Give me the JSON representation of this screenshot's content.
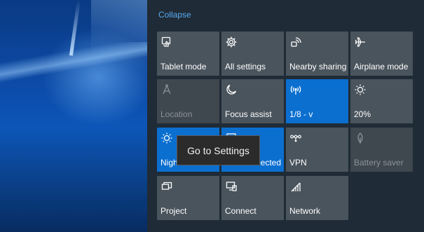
{
  "action_center": {
    "collapse_label": "Collapse",
    "tooltip": "Go to Settings",
    "tiles": [
      {
        "label": "Tablet mode",
        "icon": "tablet-mode-icon",
        "state": "off"
      },
      {
        "label": "All settings",
        "icon": "gear-icon",
        "state": "off"
      },
      {
        "label": "Nearby sharing",
        "icon": "nearby-sharing-icon",
        "state": "off"
      },
      {
        "label": "Airplane mode",
        "icon": "airplane-icon",
        "state": "off"
      },
      {
        "label": "Location",
        "icon": "location-icon",
        "state": "disabled"
      },
      {
        "label": "Focus assist",
        "icon": "moon-icon",
        "state": "off"
      },
      {
        "label": "1/8 - v",
        "icon": "mobile-hotspot-icon",
        "state": "on"
      },
      {
        "label": "20%",
        "icon": "brightness-icon",
        "state": "off"
      },
      {
        "label": "Nigh",
        "icon": "night-light-icon",
        "state": "on"
      },
      {
        "label": "ected",
        "icon": "network-connected-icon",
        "state": "on"
      },
      {
        "label": "VPN",
        "icon": "vpn-icon",
        "state": "off"
      },
      {
        "label": "Battery saver",
        "icon": "battery-saver-icon",
        "state": "disabled"
      },
      {
        "label": "Project",
        "icon": "project-icon",
        "state": "off"
      },
      {
        "label": "Connect",
        "icon": "connect-icon",
        "state": "off"
      },
      {
        "label": "Network",
        "icon": "network-icon",
        "state": "off"
      }
    ]
  },
  "colors": {
    "accent": "#0b6fd0",
    "tile": "#4a545d",
    "panel": "#1f2b36",
    "link": "#5aaaf2"
  }
}
